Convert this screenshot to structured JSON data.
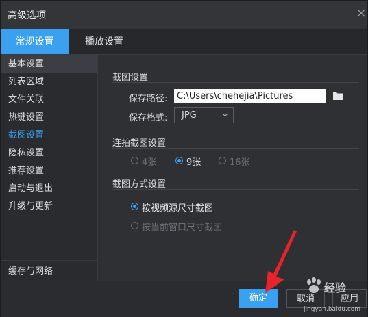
{
  "window": {
    "title": "高级选项"
  },
  "tabs": [
    {
      "label": "常规设置",
      "active": true
    },
    {
      "label": "播放设置",
      "active": false
    }
  ],
  "sidebar": {
    "items": [
      {
        "label": "基本设置"
      },
      {
        "label": "列表区域"
      },
      {
        "label": "文件关联"
      },
      {
        "label": "热键设置"
      },
      {
        "label": "截图设置",
        "active": true
      },
      {
        "label": "隐私设置"
      },
      {
        "label": "推荐设置"
      },
      {
        "label": "启动与退出"
      },
      {
        "label": "升级与更新"
      }
    ],
    "bottom_item": {
      "label": "缓存与网络"
    }
  },
  "screenshot_settings": {
    "section_title": "截图设置",
    "save_path_label": "保存路径:",
    "save_path_value": "C:\\Users\\chehejia\\Pictures",
    "save_format_label": "保存格式:",
    "save_format_value": "JPG"
  },
  "burst_settings": {
    "section_title": "连拍截图设置",
    "options": [
      {
        "label": "4张",
        "selected": false
      },
      {
        "label": "9张",
        "selected": true
      },
      {
        "label": "16张",
        "selected": false
      }
    ]
  },
  "capture_mode": {
    "section_title": "截图方式设置",
    "options": [
      {
        "label": "按视频源尺寸截图",
        "selected": true
      },
      {
        "label": "按当前窗口尺寸截图",
        "selected": false
      }
    ]
  },
  "footer": {
    "ok_label": "确定",
    "cancel_label": "取消",
    "apply_label": "应用"
  },
  "watermark": {
    "text": "经验",
    "sub": "jingyan.baidu.com"
  },
  "colors": {
    "accent": "#3aa0f0",
    "background": "#2f3034",
    "annotation_arrow": "#e8232a"
  }
}
